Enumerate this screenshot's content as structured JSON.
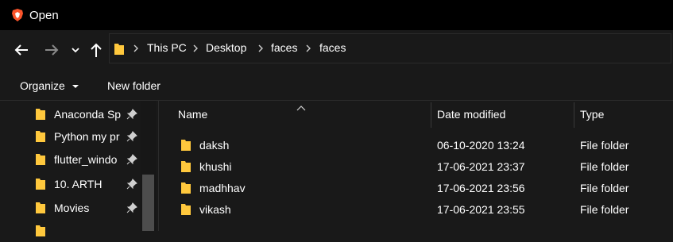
{
  "window": {
    "title": "Open"
  },
  "address": {
    "crumbs": [
      "This PC",
      "Desktop",
      "faces",
      "faces"
    ]
  },
  "toolbar": {
    "organize_label": "Organize",
    "new_folder_label": "New folder"
  },
  "nav_pane": {
    "items": [
      {
        "label": "Anaconda Sp",
        "pinned": true
      },
      {
        "label": "Python my pr",
        "pinned": true
      },
      {
        "label": "flutter_windo",
        "pinned": true
      },
      {
        "label": "10. ARTH",
        "pinned": true
      },
      {
        "label": "Movies",
        "pinned": true
      }
    ]
  },
  "file_list": {
    "columns": [
      "Name",
      "Date modified",
      "Type"
    ],
    "rows": [
      {
        "name": "daksh",
        "date": "06-10-2020 13:24",
        "type": "File folder"
      },
      {
        "name": "khushi",
        "date": "17-06-2021 23:37",
        "type": "File folder"
      },
      {
        "name": "madhhav",
        "date": "17-06-2021 23:56",
        "type": "File folder"
      },
      {
        "name": "vikash",
        "date": "17-06-2021 23:55",
        "type": "File folder"
      }
    ]
  },
  "icons": {
    "app": "brave-browser-icon",
    "back": "back-arrow-icon",
    "forward": "forward-arrow-icon",
    "recent": "chevron-down-icon",
    "up": "up-arrow-icon",
    "folder": "folder-icon",
    "pin": "pin-icon"
  },
  "colors": {
    "folder": "#ffc83d",
    "background": "#191919",
    "titlebar": "#000000"
  }
}
